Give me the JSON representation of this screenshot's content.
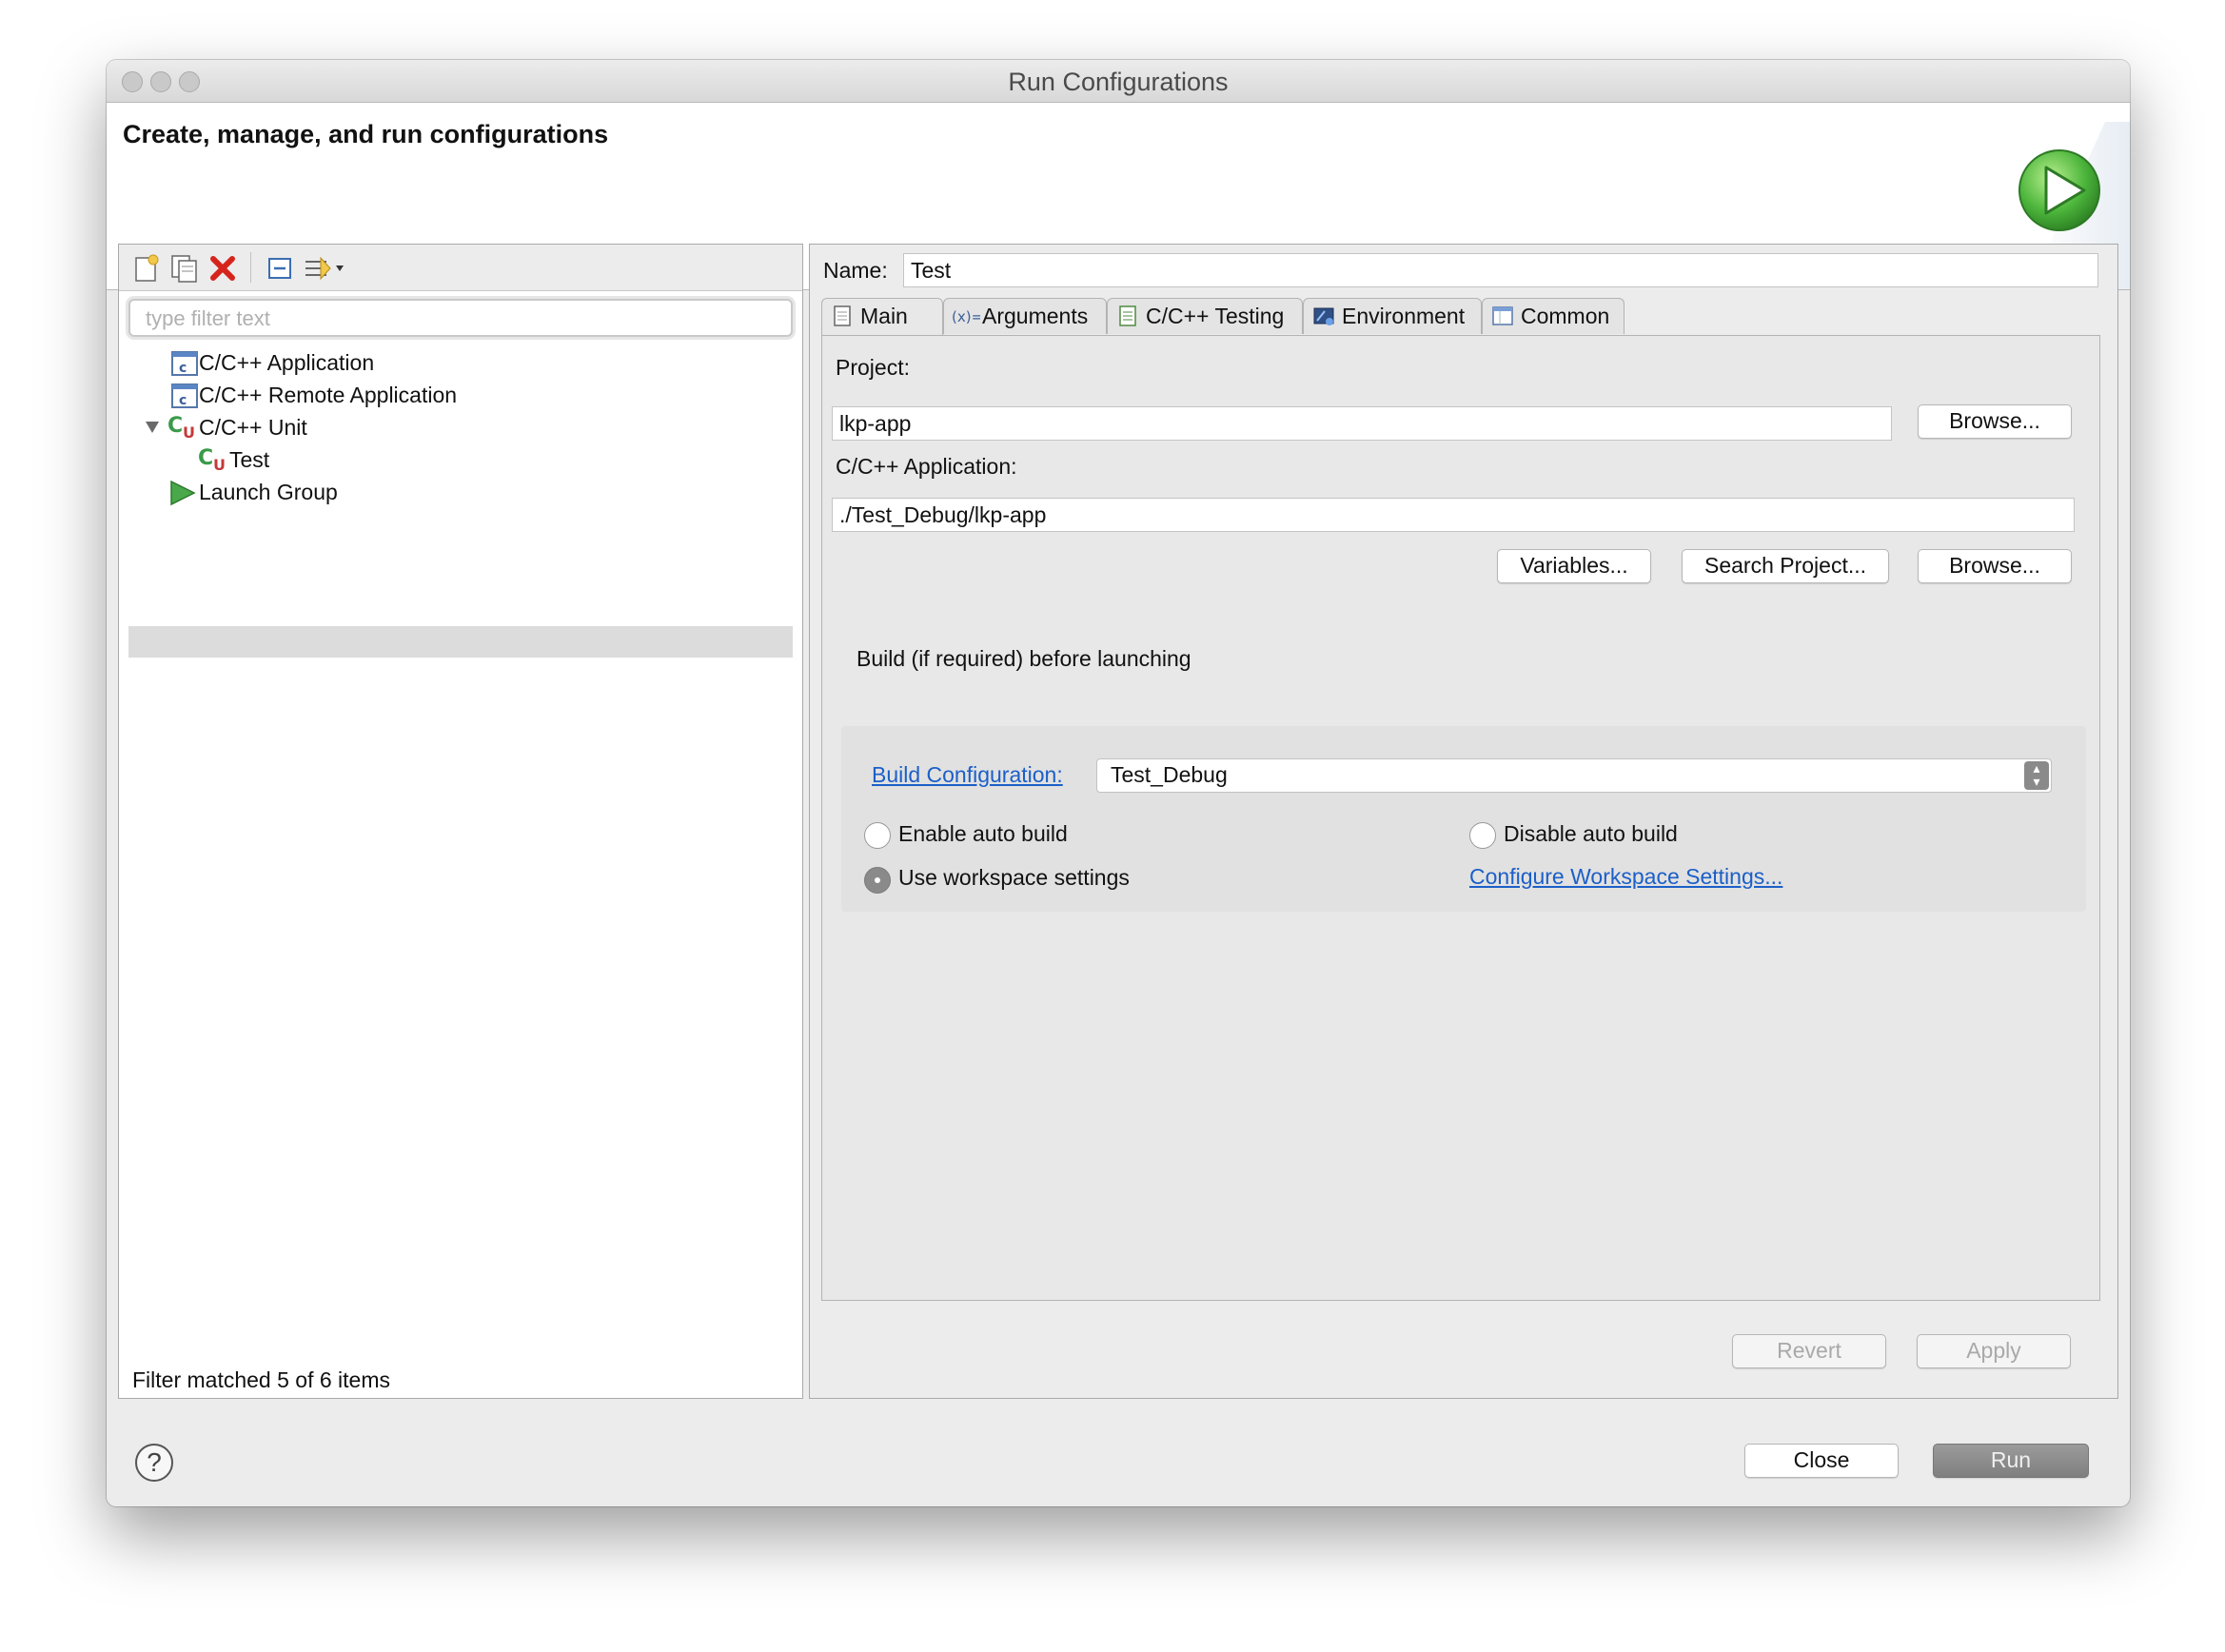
{
  "window": {
    "title": "Run Configurations",
    "header_title": "Create, manage, and run configurations"
  },
  "left": {
    "toolbar": [
      "new-config-icon",
      "duplicate-icon",
      "delete-icon",
      "collapse-all-icon",
      "filter-icon"
    ],
    "filter_placeholder": "type filter text",
    "tree": {
      "cpp_application": "C/C++ Application",
      "cpp_remote_application": "C/C++ Remote Application",
      "cpp_unit": "C/C++ Unit",
      "test": "Test",
      "launch_group": "Launch Group"
    },
    "status": "Filter matched 5 of 6 items"
  },
  "right": {
    "name_label": "Name:",
    "name_value": "Test",
    "tabs": [
      "Main",
      "Arguments",
      "C/C++ Testing",
      "Environment",
      "Common"
    ],
    "project_label": "Project:",
    "project_value": "lkp-app",
    "browse_label": "Browse...",
    "application_label": "C/C++ Application:",
    "application_value": "./Test_Debug/lkp-app",
    "variables_label": "Variables...",
    "search_project_label": "Search Project...",
    "browse2_label": "Browse...",
    "build_section_label": "Build (if required) before launching",
    "build_config_link": "Build Configuration:",
    "build_config_value": "Test_Debug",
    "enable_auto_build": "Enable auto build",
    "disable_auto_build": "Disable auto build",
    "use_workspace_settings": "Use workspace settings",
    "configure_workspace_link": "Configure Workspace Settings...",
    "revert_label": "Revert",
    "apply_label": "Apply"
  },
  "footer": {
    "help_icon": "?",
    "close_label": "Close",
    "run_label": "Run"
  },
  "colors": {
    "link": "#1b5fc8",
    "run_green": "#3aa336",
    "selection": "#dcdcdc"
  }
}
